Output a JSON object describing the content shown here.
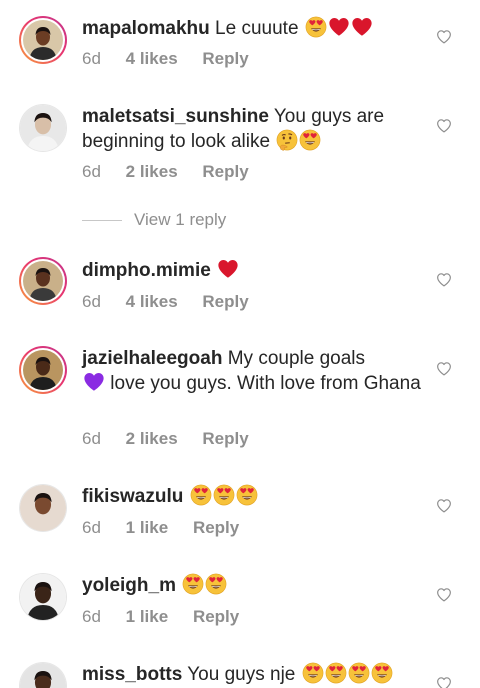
{
  "comments": [
    {
      "username": "mapalomakhu",
      "text": "Le cuuute",
      "emojis": [
        "heart-eyes",
        "red-heart",
        "red-heart"
      ],
      "time": "6d",
      "likes": "4 likes",
      "reply": "Reply",
      "avatar": {
        "ring": true,
        "bg": "#d8c7a8",
        "skin": "#6b3d24",
        "cloth": "#2b2b2b"
      }
    },
    {
      "username": "maletsatsi_sunshine",
      "text": "You guys are beginning to look alike",
      "emojis": [
        "thinking",
        "heart-eyes"
      ],
      "time": "6d",
      "likes": "2 likes",
      "reply": "Reply",
      "avatar": {
        "ring": false,
        "bg": "#e8e8e8",
        "skin": "#d8bfa8",
        "cloth": "#f4f4f4"
      }
    },
    {
      "username": "dimpho.mimie",
      "text": "",
      "emojis": [
        "red-heart"
      ],
      "time": "6d",
      "likes": "4 likes",
      "reply": "Reply",
      "avatar": {
        "ring": true,
        "bg": "#c9b089",
        "skin": "#5a321f",
        "cloth": "#3a3a3a"
      }
    },
    {
      "username": "jazielhaleegoah",
      "text": "My couple goals",
      "text2": "love you guys. With love from Ghana",
      "emojis": [
        "purple-heart"
      ],
      "time": "6d",
      "likes": "2 likes",
      "reply": "Reply",
      "avatar": {
        "ring": true,
        "bg": "#b99560",
        "skin": "#4a2a18",
        "cloth": "#1e1e1e"
      }
    },
    {
      "username": "fikiswazulu",
      "text": "",
      "emojis": [
        "heart-eyes",
        "heart-eyes",
        "heart-eyes"
      ],
      "time": "6d",
      "likes": "1 like",
      "reply": "Reply",
      "avatar": {
        "ring": false,
        "bg": "#e6dad0",
        "skin": "#7a4a30",
        "cloth": "#e6dad0"
      }
    },
    {
      "username": "yoleigh_m",
      "text": "",
      "emojis": [
        "heart-eyes",
        "heart-eyes"
      ],
      "time": "6d",
      "likes": "1 like",
      "reply": "Reply",
      "avatar": {
        "ring": false,
        "bg": "#f2f2f2",
        "skin": "#3a2418",
        "cloth": "#222222"
      }
    },
    {
      "username": "miss_botts",
      "text": "You guys nje",
      "emojis": [
        "heart-eyes",
        "heart-eyes",
        "heart-eyes",
        "heart-eyes"
      ],
      "avatar": {
        "ring": false,
        "bg": "#e4e4e4",
        "skin": "#4a2c1c",
        "cloth": "#222222"
      }
    }
  ],
  "view_replies_label": "View 1 reply",
  "colors": {
    "text": "#262626",
    "secondary": "#8e8e8e",
    "ring_start": "#f9a13a",
    "ring_end": "#c1358f",
    "heart_red": "#d9162c",
    "purple_heart": "#8a2be2",
    "emoji_yellow": "#f7c23a"
  }
}
